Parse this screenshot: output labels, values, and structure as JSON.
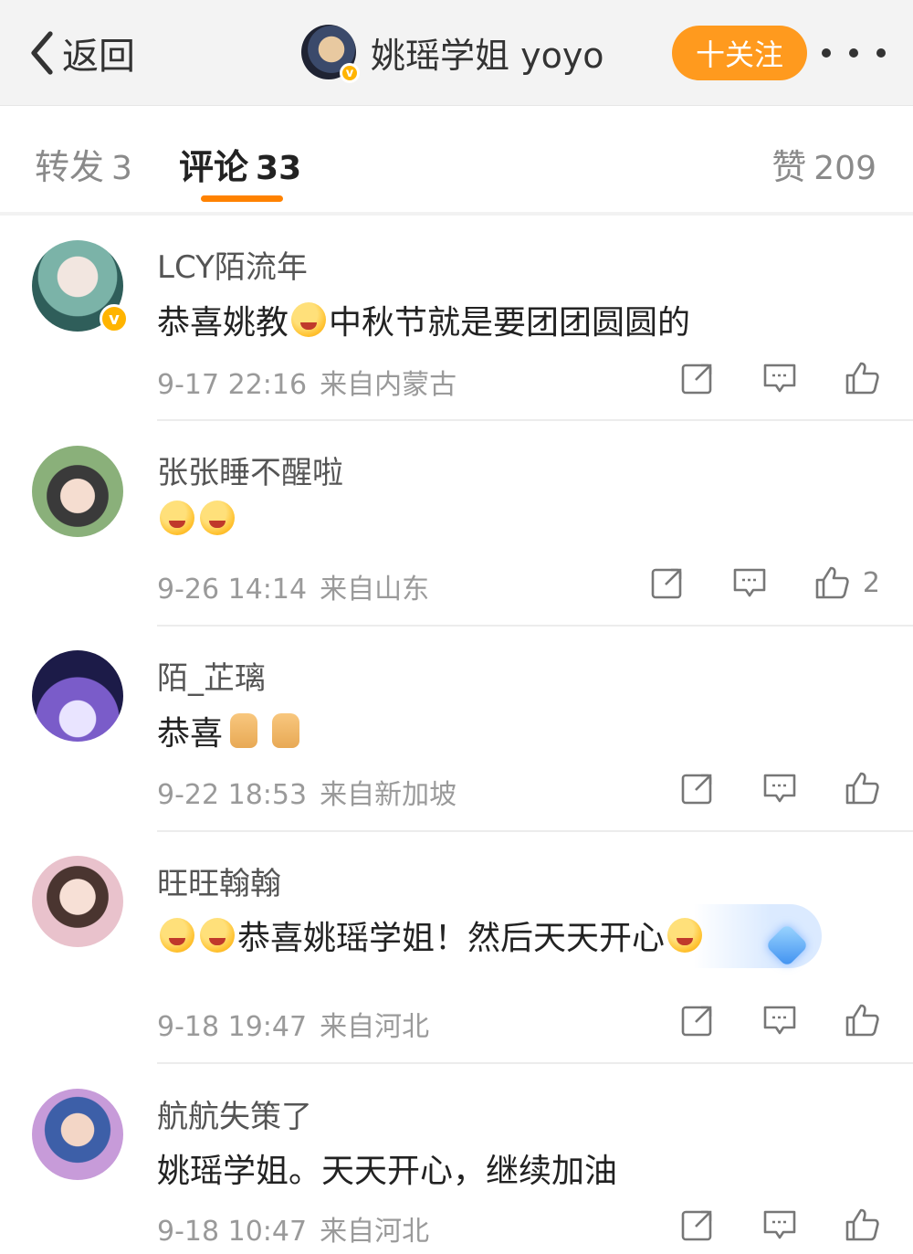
{
  "header": {
    "back_label": "返回",
    "title": "姚瑶学姐 yoyo",
    "follow_label": "十关注",
    "badge_char": "v"
  },
  "tabs": {
    "repost": {
      "label": "转发",
      "count": "3"
    },
    "comment": {
      "label": "评论",
      "count": "33"
    },
    "like": {
      "label": "赞",
      "count": "209"
    }
  },
  "comments": [
    {
      "user": "LCY陌流年",
      "verified_badge": "v",
      "text_a": "恭喜姚教",
      "text_b": "中秋节就是要团团圆圆的",
      "time": "9-17 22:16",
      "location": "来自内蒙古",
      "likes": ""
    },
    {
      "user": "张张睡不醒啦",
      "text": "",
      "time": "9-26 14:14",
      "location": "来自山东",
      "likes": "2"
    },
    {
      "user": "陌_芷璃",
      "text": "恭喜",
      "time": "9-22 18:53",
      "location": "来自新加坡",
      "likes": ""
    },
    {
      "user": "旺旺翰翰",
      "text": "恭喜姚瑶学姐！然后天天开心",
      "time": "9-18 19:47",
      "location": "来自河北",
      "likes": ""
    },
    {
      "user": "航航失策了",
      "text": "姚瑶学姐。天天开心，继续加油",
      "time": "9-18 10:47",
      "location": "来自河北",
      "likes": ""
    }
  ],
  "icons": {
    "back": "chevron-left-icon",
    "more": "more-dots-icon",
    "repost": "share-icon",
    "reply": "comment-icon",
    "like": "thumbs-up-icon"
  },
  "colors": {
    "accent": "#ff8200",
    "follow_button": "#ff9a1e",
    "verified": "#ffb400"
  }
}
